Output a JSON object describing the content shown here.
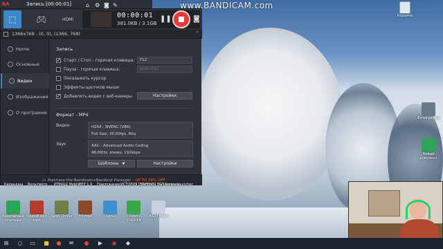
{
  "recording_toolbar": {
    "title": "Запись [00:00:01]",
    "app_short": "BA",
    "icons": [
      "home-icon",
      "settings-icon",
      "camera-icon",
      "pencil-icon"
    ]
  },
  "watermark": "www.BANDICAM.com",
  "bandicam": {
    "modes": [
      "screen-mode-icon",
      "game-mode-icon",
      "hdmi-mode-icon"
    ],
    "device_label": "HDMI",
    "timer": "00:00:01",
    "size": "381.0KB / 3.1GB",
    "region_text": "1366x768 - (0, 0), (1366, 768)",
    "sidebar": [
      {
        "label": "Home",
        "active": false
      },
      {
        "label": "Основные",
        "active": false
      },
      {
        "label": "Видео",
        "active": true
      },
      {
        "label": "Изображения",
        "active": false
      },
      {
        "label": "О программе",
        "active": false
      }
    ],
    "record_section": {
      "title": "Запись",
      "checkboxes": [
        {
          "label": "Старт / Стоп - горячая клавиша:",
          "checked": true,
          "key": "F12"
        },
        {
          "label": "Пауза - горячая клавиша:",
          "checked": false,
          "key": "Shift+F12"
        },
        {
          "label": "Показывать курсор",
          "checked": false
        },
        {
          "label": "Эффекты щелчков мыши",
          "checked": false
        },
        {
          "label": "Добавлять видео с веб-камеры",
          "checked": true
        }
      ],
      "settings_button": "Настройки"
    },
    "format_section": {
      "title": "Формат - MP4",
      "video_label": "Видео",
      "video_line1": "H264 - NVENC (VBR)",
      "video_line2": "Full Size, 30,00fps, 80q",
      "audio_label": "Звук",
      "audio_line1": "AAC - Advanced Audio Coding",
      "audio_line2": "48,0KHz, stereo, 192kbps",
      "templates_button": "Шаблоны",
      "settings_button": "Настройки"
    },
    "promo": {
      "text": "Purchase the Bandicam+Bandicut Package!",
      "highlight": "- UP TO 28% OFF"
    }
  },
  "desktop": {
    "trash_label": "Корзина",
    "bottom_row_labels": [
      "Корзина",
      "Безопасные платежи",
      "OpenIA Red Alert",
      "Tanki Online",
      "ЭЭ.mp4",
      "Сеть",
      "Сент STALKER",
      "ASRP Build"
    ],
    "top_row_labels": [
      "Карандаш",
      "Вольтметр",
      "ИТМАШ Mobile",
      "ВЕР 1.9",
      "Приложение",
      "ИСТОРИЯ Прилож.",
      "ЕРИТЕЛЯ Вычисления",
      "GT Series Launcher"
    ],
    "side_labels": [
      "Фотографии",
      "Новый документ"
    ]
  },
  "taskbar": {
    "icons": [
      "start-icon",
      "search-icon",
      "task-view-icon",
      "folder-icon",
      "chrome-icon",
      "mail-icon",
      "bandicam-icon",
      "player-icon",
      "record-icon",
      "app-icon"
    ]
  },
  "colors": {
    "accent": "#3c86c9",
    "record": "#e33b3b",
    "headset": "#22d36a",
    "promo_highlight": "#ff5a3c"
  }
}
